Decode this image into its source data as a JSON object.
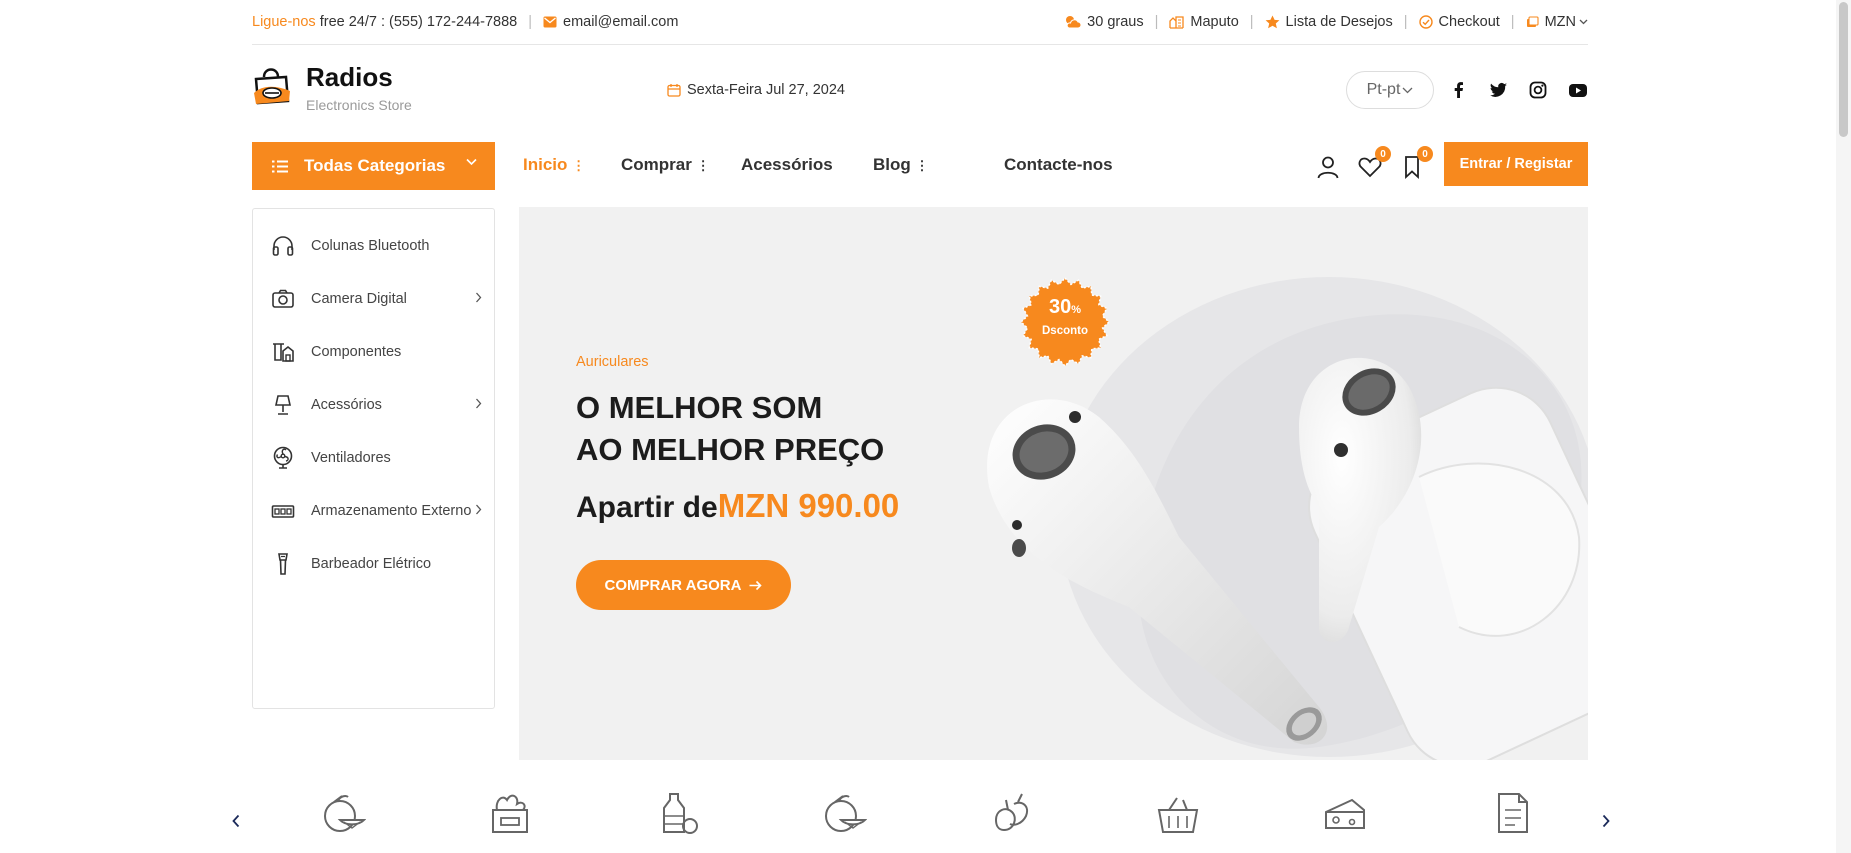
{
  "topbar": {
    "call_label": "Ligue-nos",
    "call_text": "free 24/7 : (555) 172-244-7888",
    "email": "email@email.com",
    "weather": "30 graus",
    "city": "Maputo",
    "wishlist": "Lista de Desejos",
    "checkout": "Checkout",
    "currency": "MZN"
  },
  "header": {
    "brand": "Radios",
    "tagline": "Electronics Store",
    "date": "Sexta-Feira Jul 27, 2024",
    "language": "Pt-pt"
  },
  "nav": {
    "categories_button": "Todas Categorias",
    "items": [
      "Inicio",
      "Comprar",
      "Acessórios",
      "Blog",
      "Contacte-nos"
    ],
    "wishlist_count": "0",
    "saved_count": "0",
    "login_button": "Entrar / Registar"
  },
  "sidebar": {
    "items": [
      {
        "label": "Colunas Bluetooth",
        "icon": "headphones-icon",
        "has_submenu": false
      },
      {
        "label": "Camera Digital",
        "icon": "camera-icon",
        "has_submenu": true
      },
      {
        "label": "Componentes",
        "icon": "components-icon",
        "has_submenu": false
      },
      {
        "label": "Acessórios",
        "icon": "lamp-icon",
        "has_submenu": true
      },
      {
        "label": "Ventiladores",
        "icon": "fan-icon",
        "has_submenu": false
      },
      {
        "label": "Armazenamento Externo",
        "icon": "storage-icon",
        "has_submenu": true
      },
      {
        "label": "Barbeador Elétrico",
        "icon": "shaver-icon",
        "has_submenu": false
      }
    ]
  },
  "hero": {
    "subtitle": "Auriculares",
    "title_line1": "O MELHOR SOM",
    "title_line2": "AO MELHOR PREÇO",
    "price_prefix": "Apartir de",
    "price": "MZN 990.00",
    "cta": "COMPRAR AGORA",
    "badge_percent": "30",
    "badge_percent_sign": "%",
    "badge_label": "Dsconto"
  },
  "category_icons": [
    "fruit-icon",
    "grocery-box-icon",
    "bottle-icon",
    "fruit-icon",
    "vegetables-icon",
    "basket-icon",
    "cheese-icon",
    "document-icon"
  ],
  "colors": {
    "accent": "#f7891e",
    "text": "#222222",
    "muted": "#9a9a9a"
  }
}
